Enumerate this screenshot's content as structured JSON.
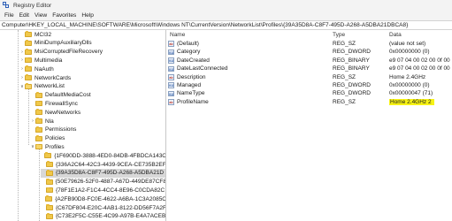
{
  "window": {
    "title": "Registry Editor"
  },
  "menu": [
    "File",
    "Edit",
    "View",
    "Favorites",
    "Help"
  ],
  "address": "Computer\\HKEY_LOCAL_MACHINE\\SOFTWARE\\Microsoft\\Windows NT\\CurrentVersion\\NetworkList\\Profiles\\{39A35D8A-C8F7-495D-A268-A5DBA21DBCA8}",
  "tree": [
    {
      "label": "MCI32",
      "level": 0,
      "expanded": null
    },
    {
      "label": "MiniDumpAuxiliaryDlls",
      "level": 0,
      "expanded": null
    },
    {
      "label": "MsiCorruptedFileRecovery",
      "level": 0,
      "expanded": false
    },
    {
      "label": "Multimedia",
      "level": 0,
      "expanded": false
    },
    {
      "label": "NaAuth",
      "level": 0,
      "expanded": false
    },
    {
      "label": "NetworkCards",
      "level": 0,
      "expanded": false
    },
    {
      "label": "NetworkList",
      "level": 0,
      "expanded": true
    },
    {
      "label": "DefaultMediaCost",
      "level": 1,
      "expanded": null
    },
    {
      "label": "FirewallSync",
      "level": 1,
      "expanded": null
    },
    {
      "label": "NewNetworks",
      "level": 1,
      "expanded": null
    },
    {
      "label": "Nla",
      "level": 1,
      "expanded": false
    },
    {
      "label": "Permissions",
      "level": 1,
      "expanded": null
    },
    {
      "label": "Policies",
      "level": 1,
      "expanded": null
    },
    {
      "label": "Profiles",
      "level": 1,
      "expanded": true
    },
    {
      "label": "{1F690DD-3888-4ED0-84DB-4FBDCA143C",
      "level": 2,
      "expanded": null
    },
    {
      "label": "{336A2C64-42C3-4439-9CEA-CE735B2EF",
      "level": 2,
      "expanded": null
    },
    {
      "label": "{39A35D8A-C8F7-495D-A268-A5DBA21D",
      "level": 2,
      "expanded": null,
      "selected": true
    },
    {
      "label": "{50E79626-52F0-4887-A67D-449DE87CF8",
      "level": 2,
      "expanded": null
    },
    {
      "label": "{78F1E1A2-F1C4-4CC4-8E96-C0CDA82C",
      "level": 2,
      "expanded": null
    },
    {
      "label": "{A2FB90D8-FC0E-4622-A6BA-1C3A2085C",
      "level": 2,
      "expanded": null
    },
    {
      "label": "{C67DF804-E20C-4AB1-8122-DD56F7A2F",
      "level": 2,
      "expanded": null
    },
    {
      "label": "{C73E2F5C-C55E-4C99-A97B-E4A7ACEB",
      "level": 2,
      "expanded": null
    }
  ],
  "columns": {
    "name": "Name",
    "type": "Type",
    "data": "Data"
  },
  "values": [
    {
      "icon": "ab",
      "name": "(Default)",
      "type": "REG_SZ",
      "data": "(value not set)"
    },
    {
      "icon": "bin",
      "name": "Category",
      "type": "REG_DWORD",
      "data": "0x00000000 (0)"
    },
    {
      "icon": "bin",
      "name": "DateCreated",
      "type": "REG_BINARY",
      "data": "e9 07 04 00 02 00 0f 00 17"
    },
    {
      "icon": "bin",
      "name": "DateLastConnected",
      "type": "REG_BINARY",
      "data": "e9 07 04 00 02 00 0f 00 17"
    },
    {
      "icon": "ab",
      "name": "Description",
      "type": "REG_SZ",
      "data": "Home 2.4GHz"
    },
    {
      "icon": "bin",
      "name": "Managed",
      "type": "REG_DWORD",
      "data": "0x00000000 (0)"
    },
    {
      "icon": "bin",
      "name": "NameType",
      "type": "REG_DWORD",
      "data": "0x00000047 (71)"
    },
    {
      "icon": "ab",
      "name": "ProfileName",
      "type": "REG_SZ",
      "data": "Home 2.4GHz 2",
      "highlight": true
    }
  ]
}
